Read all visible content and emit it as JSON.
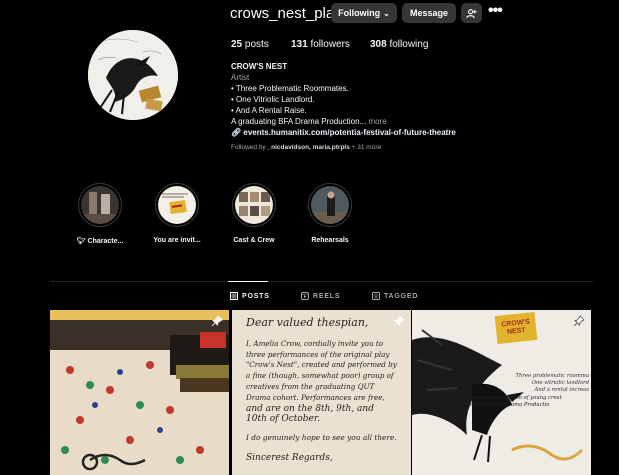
{
  "profile": {
    "username": "crows_nest_play",
    "following_button": "Following",
    "message_button": "Message",
    "stats": {
      "posts_count": "25",
      "posts_label": "posts",
      "followers_count": "131",
      "followers_label": "followers",
      "following_count": "308",
      "following_label": "following"
    },
    "bio": {
      "name": "CROW'S NEST",
      "category": "Artist",
      "line1": "• Three Problematic Roommates.",
      "line2": "• One Vitriolic Landlord.",
      "line3": "• And A Rental Raise.",
      "line4": "A graduating BFA Drama Production...",
      "more": "more",
      "link": "events.humanitix.com/potentia-festival-of-future-theatre"
    },
    "followed_by_prefix": "Followed by",
    "followed_by_names": "_nicdavidson, maria.ptrpls",
    "followed_by_more": "+ 31 more"
  },
  "highlights": [
    {
      "label": "Characte..."
    },
    {
      "label": "You are invit..."
    },
    {
      "label": "Cast & Crew"
    },
    {
      "label": "Rehearsals"
    }
  ],
  "tabs": [
    {
      "label": "POSTS",
      "active": true
    },
    {
      "label": "REELS",
      "active": false
    },
    {
      "label": "TAGGED",
      "active": false
    }
  ],
  "posts": {
    "invite": {
      "greeting": "Dear valued thespian,",
      "line1": "I, Amelia Crow, cordially invite you to",
      "line2": "three performances of the original play",
      "line3": "\"Crow's Nest\", created and performed by",
      "line4": "a fine (though, somewhat poor) group of",
      "line5": "creatives from the graduating QUT",
      "line6": "Drama cohort. Performances are free,",
      "line7": "and are on the 8th, 9th, and",
      "line8": "10th of October.",
      "line9": "I do genuinely hope to see you all there.",
      "signoff": "Sincerest Regards,"
    },
    "poster": {
      "badge": "CROW'S NEST",
      "right1": "Three problematic roomma",
      "right2": "One vitriolic landlord",
      "right3": "And a rental increas",
      "bottom1": "NEST explores the costs of exploitation of young creat",
      "bottom2": "A graduating BFA Drama Productio"
    }
  },
  "colors": {
    "background": "#000000",
    "button": "#363636",
    "secondary_text": "#a8a8a8",
    "link": "#e0f1ff"
  }
}
